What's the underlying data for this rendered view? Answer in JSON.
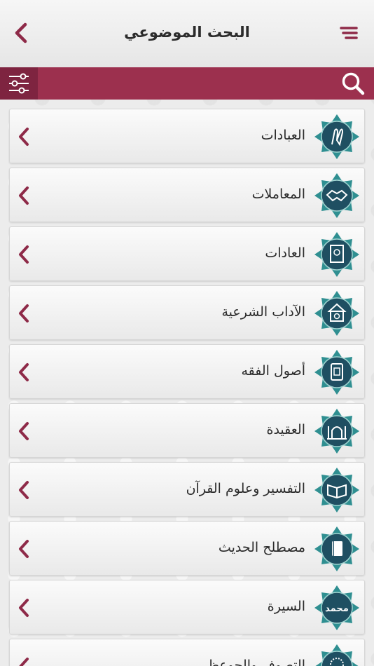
{
  "header": {
    "title": "البحث الموضوعي",
    "back_icon": "chevron-left-icon",
    "menu_icon": "hamburger-menu-icon"
  },
  "searchbar": {
    "filter_icon": "sliders-icon",
    "search_icon": "search-icon"
  },
  "colors": {
    "accent": "#9c304e",
    "accent_dark": "#7e2440",
    "badge": "#1f4f62",
    "badge_ring": "#2f8f91"
  },
  "categories": [
    {
      "label": "العبادات",
      "icon": "praying-hands-icon"
    },
    {
      "label": "المعاملات",
      "icon": "handshake-icon"
    },
    {
      "label": "العادات",
      "icon": "book-icon"
    },
    {
      "label": "الآداب الشرعية",
      "icon": "mosque-dome-icon"
    },
    {
      "label": "أصول الفقه",
      "icon": "quran-book-icon"
    },
    {
      "label": "العقيدة",
      "icon": "mosque-icon"
    },
    {
      "label": "التفسير وعلوم القرآن",
      "icon": "open-quran-icon"
    },
    {
      "label": "مصطلح الحديث",
      "icon": "hadith-book-icon"
    },
    {
      "label": "السيرة",
      "icon": "muhammad-calligraphy-icon"
    },
    {
      "label": "التصوف والحوعظ",
      "icon": "prayer-beads-icon"
    }
  ],
  "badge_text": {
    "muhammad": "محمد"
  }
}
